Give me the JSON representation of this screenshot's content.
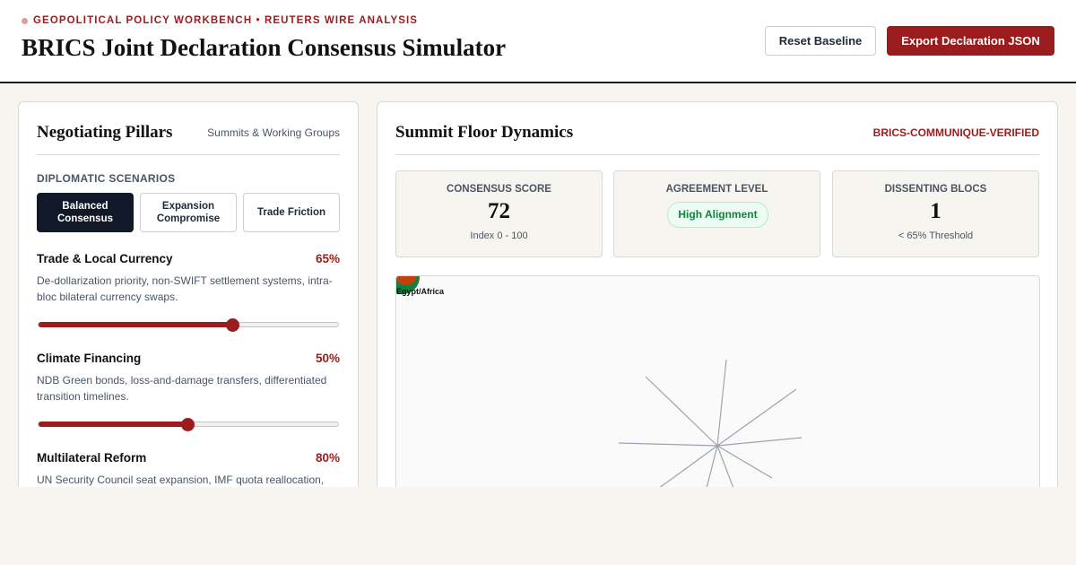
{
  "header": {
    "eyebrow": "GEOPOLITICAL POLICY WORKBENCH • REUTERS WIRE ANALYSIS",
    "title": "BRICS Joint Declaration Consensus Simulator",
    "reset_label": "Reset Baseline",
    "export_label": "Export Declaration JSON"
  },
  "pillars_panel": {
    "title": "Negotiating Pillars",
    "subtitle": "Summits & Working Groups",
    "scenarios_label": "DIPLOMATIC SCENARIOS",
    "scenarios": [
      {
        "line1": "Balanced",
        "line2": "Consensus",
        "active": true
      },
      {
        "line1": "Expansion",
        "line2": "Compromise",
        "active": false
      },
      {
        "line1": "Trade Friction",
        "line2": "",
        "active": false
      }
    ],
    "pillars": [
      {
        "name": "Trade & Local Currency",
        "percent_label": "65%",
        "value": 65,
        "desc1": "De-dollarization priority, non-SWIFT settlement systems, intra-",
        "desc2": "bloc bilateral currency swaps."
      },
      {
        "name": "Climate Financing",
        "percent_label": "50%",
        "value": 50,
        "desc1": "NDB Green bonds, loss-and-damage transfers, differentiated",
        "desc2": "transition timelines."
      },
      {
        "name": "Multilateral Reform",
        "percent_label": "80%",
        "value": 80,
        "desc1": "UN Security Council seat expansion, IMF quota reallocation,",
        "desc2": ""
      }
    ]
  },
  "dynamics_panel": {
    "title": "Summit Floor Dynamics",
    "tag": "BRICS-COMMUNIQUE-VERIFIED",
    "metrics": {
      "consensus": {
        "label": "CONSENSUS SCORE",
        "value": "72",
        "note": "Index 0 - 100"
      },
      "agreement": {
        "label": "AGREEMENT LEVEL",
        "badge": "High Alignment"
      },
      "dissent": {
        "label": "DISSENTING BLOCS",
        "value": "1",
        "note": "< 65% Threshold"
      }
    },
    "floor": {
      "overlapping_label": "Egypt/Africa",
      "node_colors": [
        "#15803d",
        "#c2410c"
      ],
      "line_color": "#9ca3af"
    }
  },
  "colors": {
    "accent": "#9b1c1c",
    "dark": "#111827",
    "success": "#15803d"
  }
}
